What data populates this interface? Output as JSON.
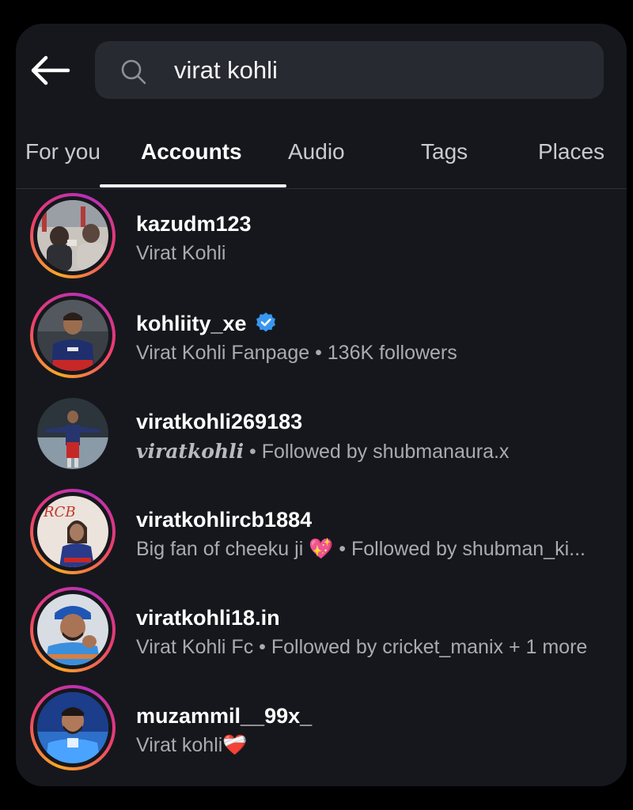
{
  "search": {
    "query": "virat kohli"
  },
  "tabs": [
    {
      "label": "For you"
    },
    {
      "label": "Accounts"
    },
    {
      "label": "Audio"
    },
    {
      "label": "Tags"
    },
    {
      "label": "Places"
    }
  ],
  "active_tab": "Accounts",
  "accounts": [
    {
      "username": "kazudm123",
      "subtitle": "Virat Kohli"
    },
    {
      "username": "kohliity_xe",
      "subtitle": "Virat Kohli Fanpage • 136K followers",
      "verified": true
    },
    {
      "username": "viratkohli269183",
      "bio_script": "viratkohli",
      "subtitle": " • Followed by shubmanaura.x"
    },
    {
      "username": "viratkohlircb1884",
      "subtitle_a": "Big fan of cheeku ji ",
      "subtitle_emoji": "💖",
      "subtitle_b": " • Followed by shubman_ki...",
      "avatar_text": "RCB"
    },
    {
      "username": "viratkohli18.in",
      "subtitle": "Virat Kohli Fc • Followed by cricket_manix + 1 more"
    },
    {
      "username": "muzammil__99x_",
      "subtitle_a": "Virat kohli",
      "subtitle_emoji": "❤️‍🩹"
    }
  ],
  "colors": {
    "background": "#000000",
    "panel": "#16171c",
    "search_field": "#272a31",
    "verified_badge": "#3897f0",
    "ring_gradient": [
      "#f9a825",
      "#ec3d6e",
      "#b62fb8"
    ]
  }
}
